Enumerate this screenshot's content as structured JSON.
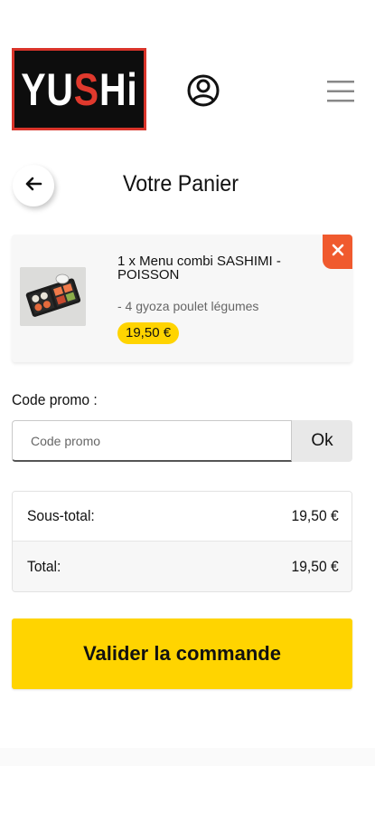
{
  "brand": {
    "logo_prefix": "YU",
    "logo_accent": "S",
    "logo_suffix": "Hi",
    "accent_color": "#e0392d"
  },
  "header": {
    "account_icon": "user-circle-icon",
    "menu_icon": "hamburger-menu-icon"
  },
  "page": {
    "back_icon": "arrow-left-icon",
    "title": "Votre Panier"
  },
  "cart": {
    "items": [
      {
        "title": "1 x Menu combi SASHIMI - POISSON",
        "option": "- 4 gyoza poulet légumes",
        "price": "19,50 €",
        "remove_icon": "close-icon",
        "image_icon": "sushi-box-image"
      }
    ]
  },
  "promo": {
    "label": "Code promo :",
    "placeholder": "Code promo",
    "value": "",
    "button_label": "Ok"
  },
  "totals": {
    "subtotal_label": "Sous-total:",
    "subtotal_value": "19,50 €",
    "total_label": "Total:",
    "total_value": "19,50 €"
  },
  "submit": {
    "label": "Valider la commande",
    "color": "#ffd400"
  },
  "colors": {
    "price_badge": "#ffd400",
    "remove_button": "#f05a2e",
    "logo_background": "#0d0d0d"
  }
}
